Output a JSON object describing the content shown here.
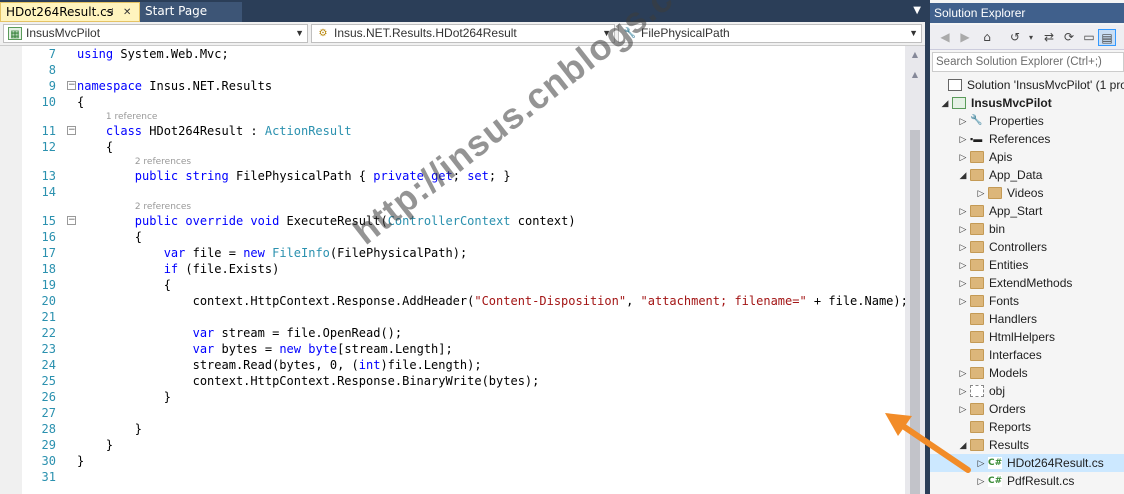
{
  "tabs": [
    {
      "label": "HDot264Result.cs",
      "active": true,
      "pin_icon": "pin-icon",
      "close_icon": "close-icon"
    },
    {
      "label": "Start Page",
      "active": false
    }
  ],
  "nav": {
    "project": "InsusMvcPilot",
    "class": "Insus.NET.Results.HDot264Result",
    "member": "FilePhysicalPath"
  },
  "code_lines": [
    {
      "n": "7",
      "text": "using System.Web.Mvc;"
    },
    {
      "n": "8",
      "text": ""
    },
    {
      "n": "9",
      "text": "namespace Insus.NET.Results"
    },
    {
      "n": "10",
      "text": "{"
    },
    {
      "n": "11",
      "text": "    class HDot264Result : ActionResult",
      "ref": "1 reference"
    },
    {
      "n": "12",
      "text": "    {"
    },
    {
      "n": "13",
      "text": "        public string FilePhysicalPath { private get; set; }",
      "ref": "2 references"
    },
    {
      "n": "14",
      "text": ""
    },
    {
      "n": "15",
      "text": "        public override void ExecuteResult(ControllerContext context)",
      "ref": "2 references"
    },
    {
      "n": "16",
      "text": "        {"
    },
    {
      "n": "17",
      "text": "            var file = new FileInfo(FilePhysicalPath);"
    },
    {
      "n": "18",
      "text": "            if (file.Exists)"
    },
    {
      "n": "19",
      "text": "            {"
    },
    {
      "n": "20",
      "text": "                context.HttpContext.Response.AddHeader(\"Content-Disposition\", \"attachment; filename=\" + file.Name);"
    },
    {
      "n": "21",
      "text": ""
    },
    {
      "n": "22",
      "text": "                var stream = file.OpenRead();"
    },
    {
      "n": "23",
      "text": "                var bytes = new byte[stream.Length];"
    },
    {
      "n": "24",
      "text": "                stream.Read(bytes, 0, (int)file.Length);"
    },
    {
      "n": "25",
      "text": "                context.HttpContext.Response.BinaryWrite(bytes);"
    },
    {
      "n": "26",
      "text": "            }"
    },
    {
      "n": "27",
      "text": ""
    },
    {
      "n": "28",
      "text": "        }"
    },
    {
      "n": "29",
      "text": "    }"
    },
    {
      "n": "30",
      "text": "}"
    },
    {
      "n": "31",
      "text": ""
    }
  ],
  "watermark": "http://insus.cnblogs.com",
  "solution_explorer": {
    "title": "Solution Explorer",
    "search_placeholder": "Search Solution Explorer (Ctrl+;)",
    "toolbar_icons": [
      "back-icon",
      "forward-icon",
      "home-icon",
      "history-icon",
      "sync-icon",
      "refresh-icon",
      "collapse-icon"
    ],
    "tree": [
      {
        "label": "Solution 'InsusMvcPilot' (1 pro",
        "icon": "solution",
        "level": 0,
        "toggle": ""
      },
      {
        "label": "InsusMvcPilot",
        "icon": "project",
        "level": 1,
        "toggle": "open",
        "bold": true
      },
      {
        "label": "Properties",
        "icon": "wrench",
        "level": 2,
        "toggle": "closed"
      },
      {
        "label": "References",
        "icon": "refs",
        "level": 2,
        "toggle": "closed"
      },
      {
        "label": "Apis",
        "icon": "folder",
        "level": 2,
        "toggle": "closed"
      },
      {
        "label": "App_Data",
        "icon": "folder",
        "level": 2,
        "toggle": "open"
      },
      {
        "label": "Videos",
        "icon": "folder",
        "level": 3,
        "toggle": "closed"
      },
      {
        "label": "App_Start",
        "icon": "folder",
        "level": 2,
        "toggle": "closed"
      },
      {
        "label": "bin",
        "icon": "folder",
        "level": 2,
        "toggle": "closed"
      },
      {
        "label": "Controllers",
        "icon": "folder",
        "level": 2,
        "toggle": "closed"
      },
      {
        "label": "Entities",
        "icon": "folder",
        "level": 2,
        "toggle": "closed"
      },
      {
        "label": "ExtendMethods",
        "icon": "folder",
        "level": 2,
        "toggle": "closed"
      },
      {
        "label": "Fonts",
        "icon": "folder",
        "level": 2,
        "toggle": "closed"
      },
      {
        "label": "Handlers",
        "icon": "folder",
        "level": 2,
        "toggle": ""
      },
      {
        "label": "HtmlHelpers",
        "icon": "folder",
        "level": 2,
        "toggle": ""
      },
      {
        "label": "Interfaces",
        "icon": "folder",
        "level": 2,
        "toggle": ""
      },
      {
        "label": "Models",
        "icon": "folder",
        "level": 2,
        "toggle": "closed"
      },
      {
        "label": "obj",
        "icon": "folder-dashed",
        "level": 2,
        "toggle": "closed"
      },
      {
        "label": "Orders",
        "icon": "folder",
        "level": 2,
        "toggle": "closed"
      },
      {
        "label": "Reports",
        "icon": "folder",
        "level": 2,
        "toggle": ""
      },
      {
        "label": "Results",
        "icon": "folder",
        "level": 2,
        "toggle": "open"
      },
      {
        "label": "HDot264Result.cs",
        "icon": "cs",
        "level": 3,
        "toggle": "closed",
        "selected": true
      },
      {
        "label": "PdfResult.cs",
        "icon": "cs",
        "level": 3,
        "toggle": "closed"
      }
    ]
  },
  "colors": {
    "arrow": "#f28c28",
    "keyword": "#0000ff",
    "type": "#2b91af",
    "string": "#a31515",
    "line_number": "#2b91af"
  }
}
